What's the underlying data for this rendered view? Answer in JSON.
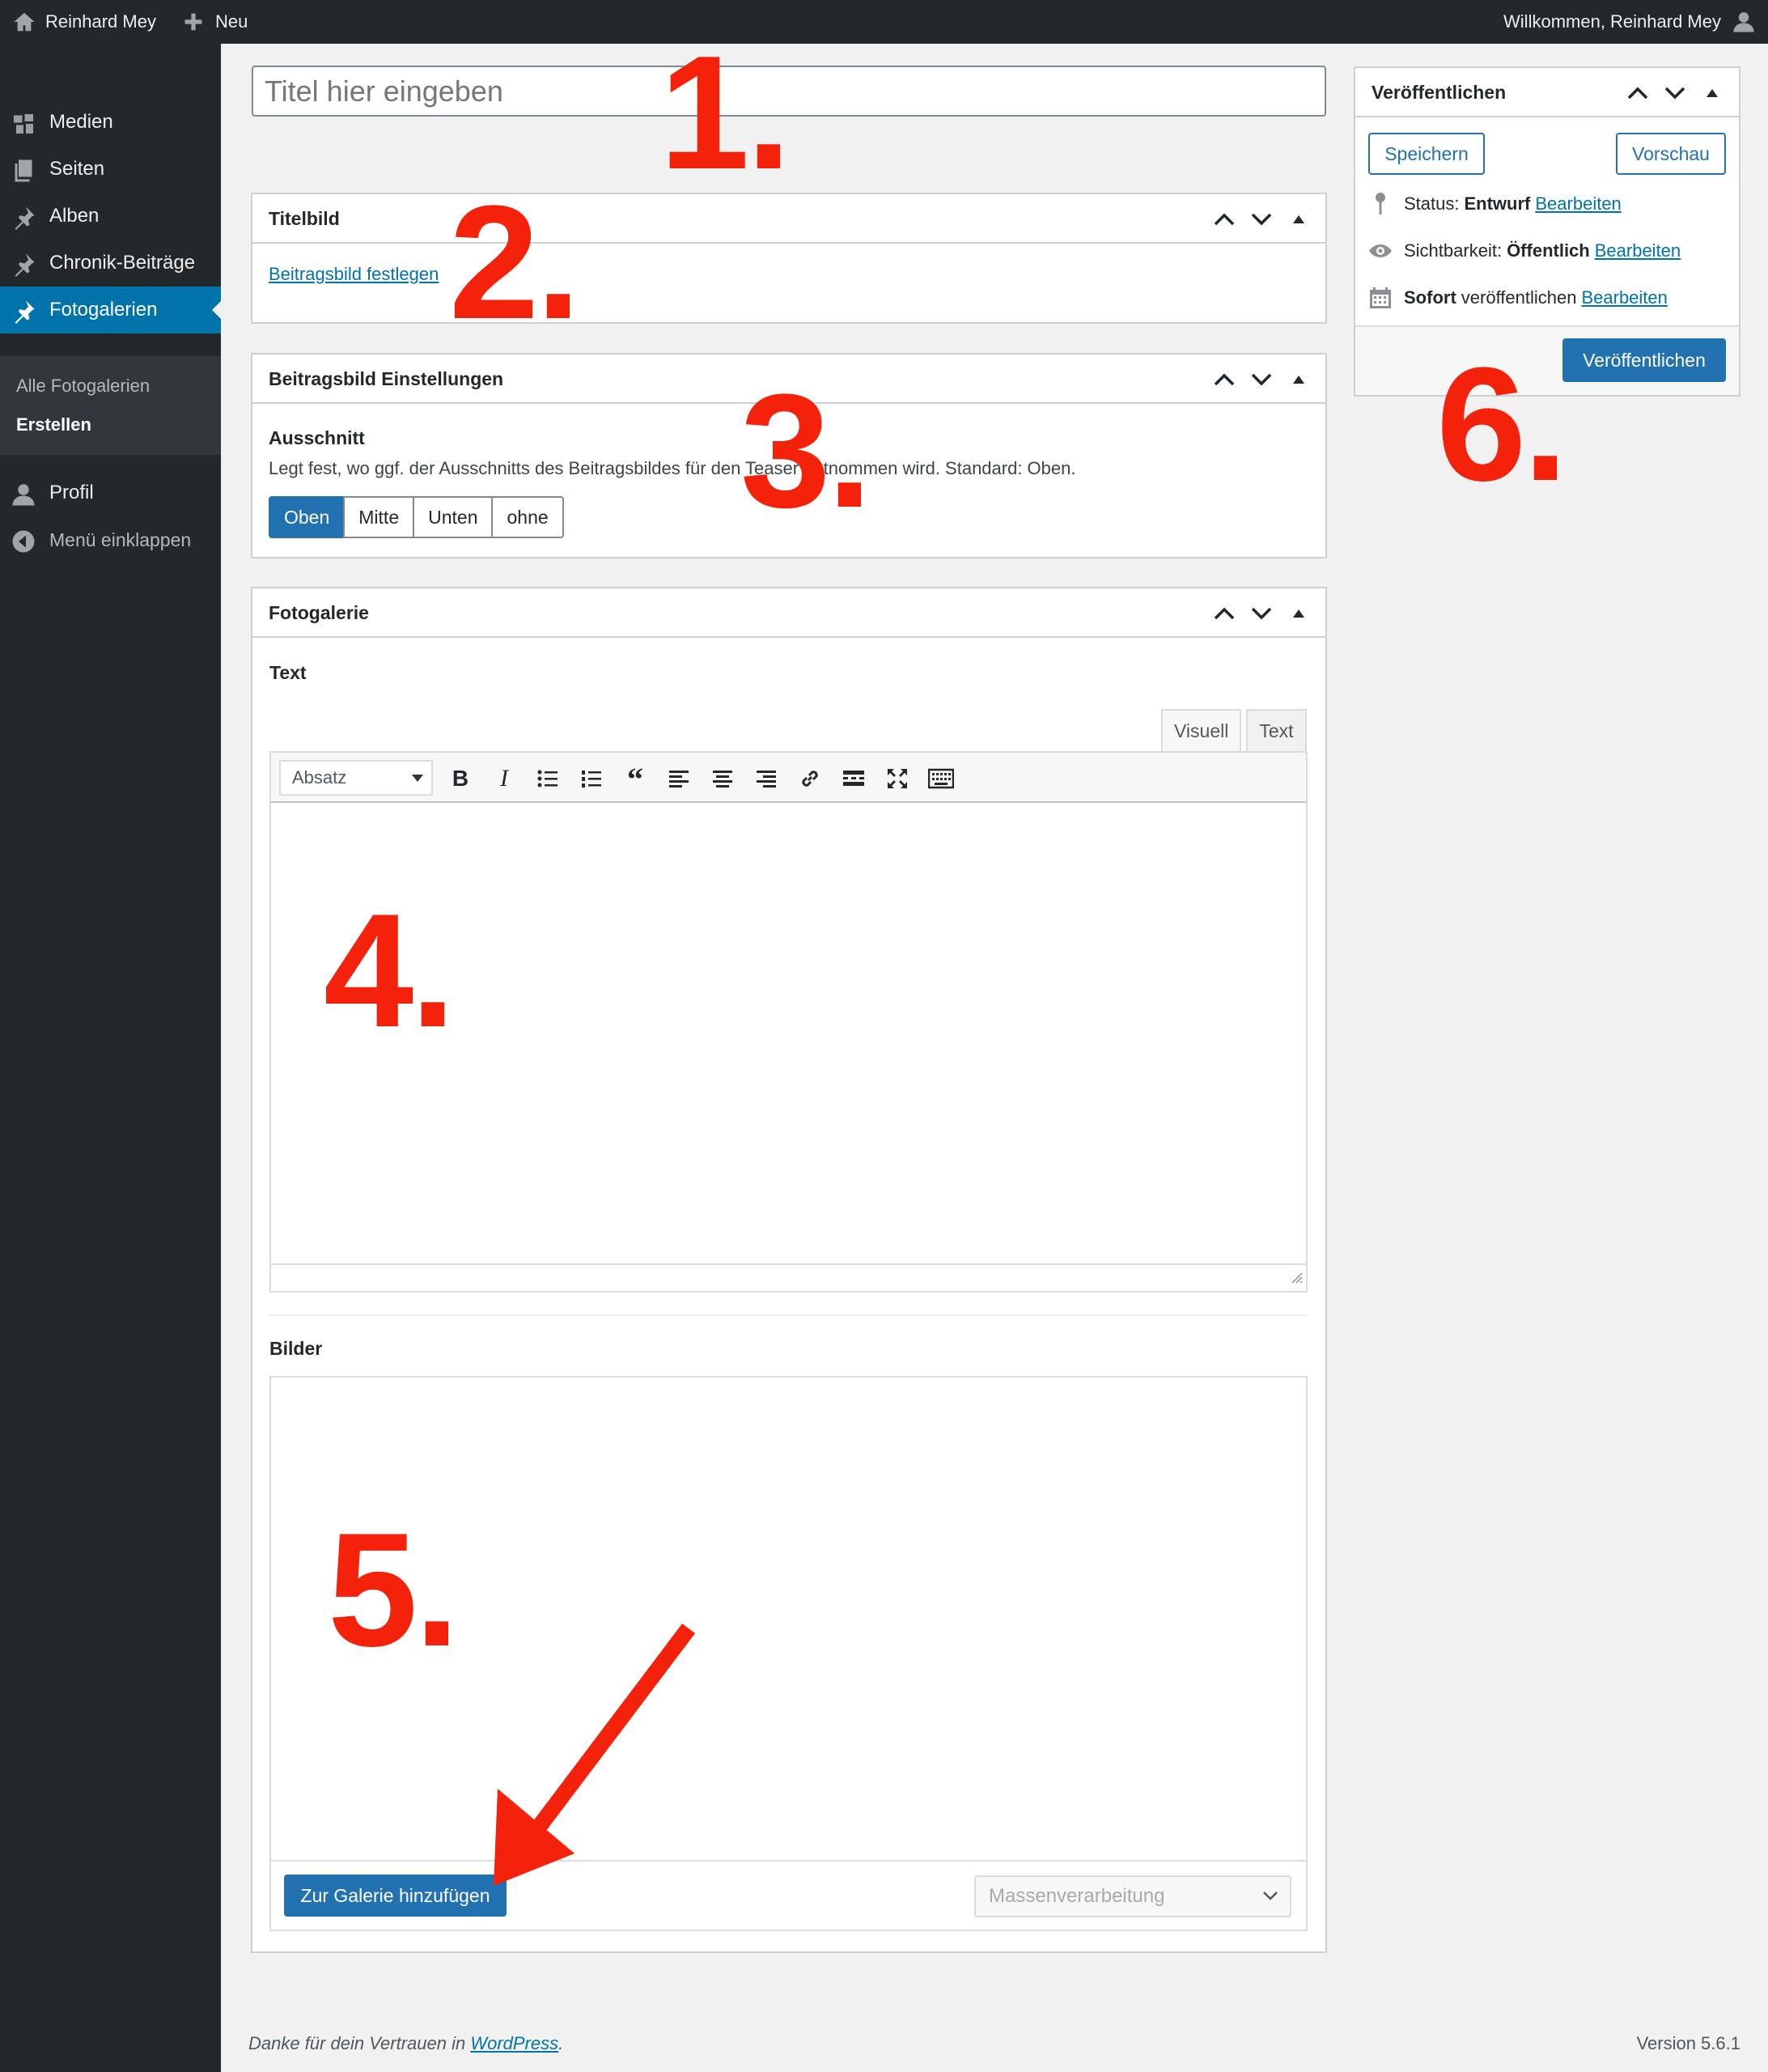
{
  "adminbar": {
    "site_name": "Reinhard Mey",
    "new_label": "Neu",
    "greeting": "Willkommen, Reinhard Mey"
  },
  "sidebar": {
    "items": [
      {
        "label": "Medien",
        "icon": "media-icon"
      },
      {
        "label": "Seiten",
        "icon": "pages-icon"
      },
      {
        "label": "Alben",
        "icon": "pin-icon"
      },
      {
        "label": "Chronik-Beiträge",
        "icon": "pin-icon"
      },
      {
        "label": "Fotogalerien",
        "icon": "pin-icon",
        "active": true
      }
    ],
    "submenu": [
      "Alle Fotogalerien",
      "Erstellen"
    ],
    "profile": "Profil",
    "collapse": "Menü einklappen"
  },
  "title": {
    "placeholder": "Titel hier eingeben"
  },
  "titelbild": {
    "heading": "Titelbild",
    "link": "Beitragsbild festlegen"
  },
  "settings": {
    "heading": "Beitragsbild Einstellungen",
    "label": "Ausschnitt",
    "description": "Legt fest, wo ggf. der Ausschnitts des Beitragsbildes für den Teaser entnommen wird. Standard: Oben.",
    "options": [
      "Oben",
      "Mitte",
      "Unten",
      "ohne"
    ],
    "selected": "Oben"
  },
  "gallery": {
    "heading": "Fotogalerie",
    "text_label": "Text",
    "tab_visual": "Visuell",
    "tab_text": "Text",
    "format_select": "Absatz",
    "images_label": "Bilder",
    "add_button": "Zur Galerie hinzufügen",
    "bulk_placeholder": "Massenverarbeitung"
  },
  "publish": {
    "heading": "Veröffentlichen",
    "save": "Speichern",
    "preview": "Vorschau",
    "status_label": "Status:",
    "status_value": "Entwurf",
    "visibility_label": "Sichtbarkeit:",
    "visibility_value": "Öffentlich",
    "schedule_bold": "Sofort",
    "schedule_rest": "veröffentlichen",
    "edit": "Bearbeiten",
    "publish_button": "Veröffentlichen"
  },
  "annotations": [
    "1.",
    "2.",
    "3.",
    "4.",
    "5.",
    "6."
  ],
  "footer": {
    "thanks_prefix": "Danke für dein Vertrauen in",
    "wordpress": "WordPress",
    "thanks_suffix": ".",
    "version": "Version 5.6.1"
  },
  "colors": {
    "accent": "#0073aa",
    "primary_button": "#2271b1",
    "annotation": "#f4220b",
    "sidebar": "#23282d"
  }
}
